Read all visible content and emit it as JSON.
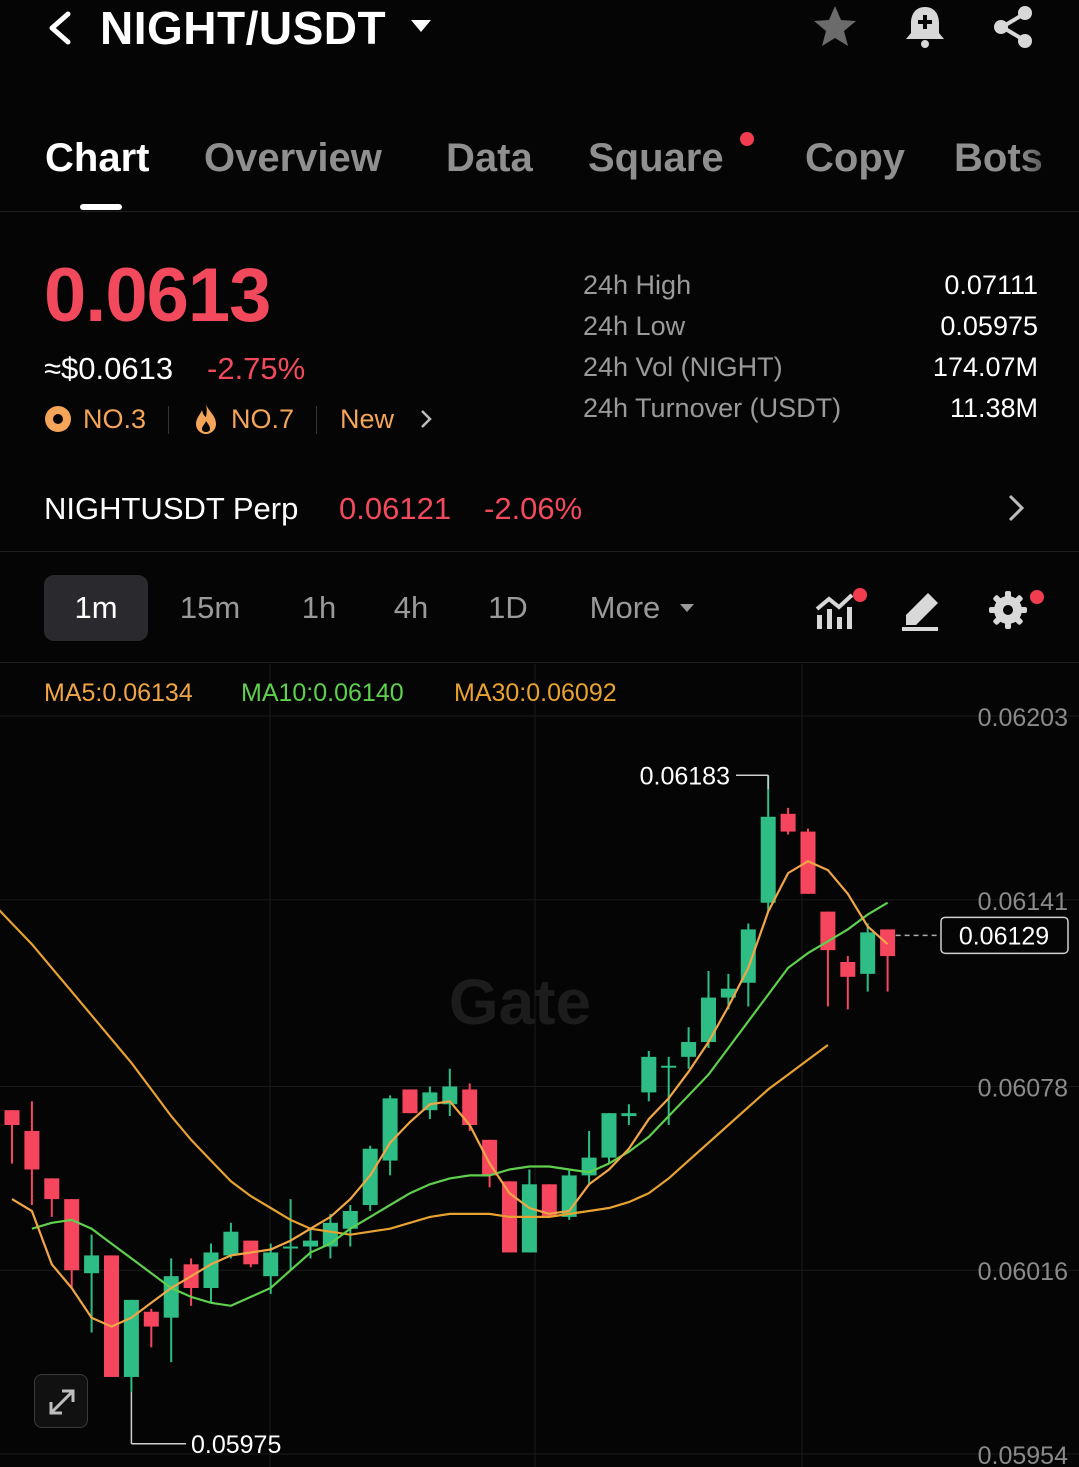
{
  "header": {
    "pair": "NIGHT/USDT",
    "icons": [
      "back-arrow-icon",
      "caret-down-icon",
      "star-icon",
      "bell-plus-icon",
      "share-icon"
    ]
  },
  "tabs": [
    {
      "label": "Chart",
      "active": true
    },
    {
      "label": "Overview"
    },
    {
      "label": "Data"
    },
    {
      "label": "Square",
      "badge": "red-dot"
    },
    {
      "label": "Copy"
    },
    {
      "label": "Bots"
    }
  ],
  "price": {
    "last": "0.0613",
    "usd": "≈$0.0613",
    "change": "-2.75%",
    "rank_trend": "NO.3",
    "rank_hot": "NO.7",
    "tag": "New"
  },
  "stats": [
    {
      "label": "24h High",
      "value": "0.07111"
    },
    {
      "label": "24h Low",
      "value": "0.05975"
    },
    {
      "label": "24h Vol (NIGHT)",
      "value": "174.07M"
    },
    {
      "label": "24h Turnover (USDT)",
      "value": "11.38M"
    }
  ],
  "perp": {
    "name": "NIGHTUSDT Perp",
    "price": "0.06121",
    "change": "-2.06%"
  },
  "intervals": {
    "items": [
      "1m",
      "15m",
      "1h",
      "4h",
      "1D"
    ],
    "active": "1m",
    "more": "More"
  },
  "colors": {
    "up": "#2ebd85",
    "down": "#f6465d",
    "ma5": "#f0a646",
    "ma10": "#5fcf4e",
    "ma30": "#e8a230",
    "price_red": "#f24a5c",
    "rank": "#f5a55a"
  },
  "chart_data": {
    "type": "candlestick",
    "interval": "1m",
    "ma_legend": {
      "ma5": "MA5:0.06134",
      "ma10": "MA10:0.06140",
      "ma30": "MA30:0.06092"
    },
    "y_ticks": [
      "0.06203",
      "0.06141",
      "0.06078",
      "0.06016",
      "0.05954"
    ],
    "ylim": [
      0.05954,
      0.06203
    ],
    "high_label": "0.06183",
    "low_label": "0.05975",
    "last_price_label": "0.06129",
    "watermark": "Gate",
    "candles": [
      {
        "o": 0.0607,
        "h": 0.0607,
        "l": 0.06052,
        "c": 0.06065
      },
      {
        "o": 0.06063,
        "h": 0.06073,
        "l": 0.06038,
        "c": 0.0605
      },
      {
        "o": 0.06047,
        "h": 0.06047,
        "l": 0.06034,
        "c": 0.0604
      },
      {
        "o": 0.0604,
        "h": 0.0604,
        "l": 0.0601,
        "c": 0.06016
      },
      {
        "o": 0.06015,
        "h": 0.06028,
        "l": 0.05995,
        "c": 0.06021
      },
      {
        "o": 0.06021,
        "h": 0.06021,
        "l": 0.0598,
        "c": 0.0598
      },
      {
        "o": 0.0598,
        "h": 0.06006,
        "l": 0.05975,
        "c": 0.06006
      },
      {
        "o": 0.06002,
        "h": 0.06003,
        "l": 0.0599,
        "c": 0.05997
      },
      {
        "o": 0.06,
        "h": 0.0602,
        "l": 0.05985,
        "c": 0.06014
      },
      {
        "o": 0.06018,
        "h": 0.0602,
        "l": 0.06004,
        "c": 0.0601
      },
      {
        "o": 0.0601,
        "h": 0.06025,
        "l": 0.06005,
        "c": 0.06022
      },
      {
        "o": 0.06021,
        "h": 0.06032,
        "l": 0.0602,
        "c": 0.06029
      },
      {
        "o": 0.06026,
        "h": 0.06026,
        "l": 0.06017,
        "c": 0.06018
      },
      {
        "o": 0.06014,
        "h": 0.06025,
        "l": 0.06008,
        "c": 0.06022
      },
      {
        "o": 0.06024,
        "h": 0.0604,
        "l": 0.06016,
        "c": 0.06024
      },
      {
        "o": 0.06024,
        "h": 0.0603,
        "l": 0.0602,
        "c": 0.06026
      },
      {
        "o": 0.06024,
        "h": 0.06035,
        "l": 0.0602,
        "c": 0.06032
      },
      {
        "o": 0.0603,
        "h": 0.06038,
        "l": 0.06024,
        "c": 0.06036
      },
      {
        "o": 0.06038,
        "h": 0.06058,
        "l": 0.06036,
        "c": 0.06057
      },
      {
        "o": 0.06053,
        "h": 0.06075,
        "l": 0.06048,
        "c": 0.06074
      },
      {
        "o": 0.06077,
        "h": 0.06077,
        "l": 0.06069,
        "c": 0.06069
      },
      {
        "o": 0.0607,
        "h": 0.06078,
        "l": 0.06067,
        "c": 0.06076
      },
      {
        "o": 0.06072,
        "h": 0.06084,
        "l": 0.06068,
        "c": 0.06078
      },
      {
        "o": 0.06077,
        "h": 0.06079,
        "l": 0.06063,
        "c": 0.06065
      },
      {
        "o": 0.0606,
        "h": 0.0606,
        "l": 0.06044,
        "c": 0.06048
      },
      {
        "o": 0.06046,
        "h": 0.06046,
        "l": 0.06022,
        "c": 0.06022
      },
      {
        "o": 0.06022,
        "h": 0.0605,
        "l": 0.06022,
        "c": 0.06045
      },
      {
        "o": 0.06045,
        "h": 0.06045,
        "l": 0.06034,
        "c": 0.06034
      },
      {
        "o": 0.06034,
        "h": 0.0605,
        "l": 0.06033,
        "c": 0.06048
      },
      {
        "o": 0.06048,
        "h": 0.06063,
        "l": 0.06045,
        "c": 0.06054
      },
      {
        "o": 0.06054,
        "h": 0.06069,
        "l": 0.06052,
        "c": 0.06069
      },
      {
        "o": 0.06068,
        "h": 0.06072,
        "l": 0.06065,
        "c": 0.06069
      },
      {
        "o": 0.06076,
        "h": 0.0609,
        "l": 0.06073,
        "c": 0.06088
      },
      {
        "o": 0.06085,
        "h": 0.06088,
        "l": 0.06065,
        "c": 0.06085
      },
      {
        "o": 0.06088,
        "h": 0.06098,
        "l": 0.06084,
        "c": 0.06093
      },
      {
        "o": 0.06093,
        "h": 0.06117,
        "l": 0.06091,
        "c": 0.06108
      },
      {
        "o": 0.06108,
        "h": 0.06116,
        "l": 0.06104,
        "c": 0.06111
      },
      {
        "o": 0.06113,
        "h": 0.06133,
        "l": 0.06105,
        "c": 0.06131
      },
      {
        "o": 0.0614,
        "h": 0.06183,
        "l": 0.06137,
        "c": 0.06169
      },
      {
        "o": 0.0617,
        "h": 0.06172,
        "l": 0.06163,
        "c": 0.06164
      },
      {
        "o": 0.06164,
        "h": 0.06165,
        "l": 0.06143,
        "c": 0.06143
      },
      {
        "o": 0.06137,
        "h": 0.06137,
        "l": 0.06105,
        "c": 0.06124
      },
      {
        "o": 0.0612,
        "h": 0.06122,
        "l": 0.06104,
        "c": 0.06115
      },
      {
        "o": 0.06116,
        "h": 0.06133,
        "l": 0.0611,
        "c": 0.0613
      },
      {
        "o": 0.06131,
        "h": 0.06131,
        "l": 0.0611,
        "c": 0.06122
      }
    ],
    "ma5": [
      0.0604,
      0.06036,
      0.06018,
      0.0601,
      0.06,
      0.05997,
      0.06,
      0.06005,
      0.0601,
      0.06014,
      0.06018,
      0.06021,
      0.06022,
      0.06023,
      0.06026,
      0.0603,
      0.06034,
      0.0604,
      0.06048,
      0.06059,
      0.06066,
      0.06072,
      0.06073,
      0.06065,
      0.06052,
      0.06042,
      0.06037,
      0.06035,
      0.06036,
      0.06045,
      0.0605,
      0.06057,
      0.06067,
      0.06074,
      0.06083,
      0.06093,
      0.06105,
      0.06118,
      0.06137,
      0.0615,
      0.06154,
      0.06151,
      0.06143,
      0.06132,
      0.06126
    ],
    "ma10": [
      0.0603,
      0.06032,
      0.06033,
      0.0603,
      0.06025,
      0.0602,
      0.06015,
      0.0601,
      0.06007,
      0.06005,
      0.06004,
      0.06007,
      0.0601,
      0.06016,
      0.06022,
      0.06025,
      0.0603,
      0.06034,
      0.06038,
      0.06042,
      0.06045,
      0.06047,
      0.06048,
      0.06048,
      0.0605,
      0.06051,
      0.06051,
      0.0605,
      0.06049,
      0.06052,
      0.06056,
      0.06061,
      0.06068,
      0.06075,
      0.06082,
      0.06091,
      0.061,
      0.06109,
      0.06118,
      0.06123,
      0.06127,
      0.06131,
      0.06136,
      0.0614
    ],
    "ma30": [
      0.0614,
      0.06133,
      0.06126,
      0.06118,
      0.0611,
      0.06102,
      0.06094,
      0.06086,
      0.06077,
      0.06068,
      0.0606,
      0.06053,
      0.06046,
      0.06041,
      0.06037,
      0.06033,
      0.0603,
      0.06029,
      0.06028,
      0.06029,
      0.0603,
      0.06032,
      0.06034,
      0.06035,
      0.06035,
      0.06035,
      0.06034,
      0.06034,
      0.06034,
      0.06035,
      0.06036,
      0.06037,
      0.06039,
      0.06042,
      0.06047,
      0.06053,
      0.06059,
      0.06065,
      0.06071,
      0.06077,
      0.06082,
      0.06087,
      0.06092
    ]
  }
}
